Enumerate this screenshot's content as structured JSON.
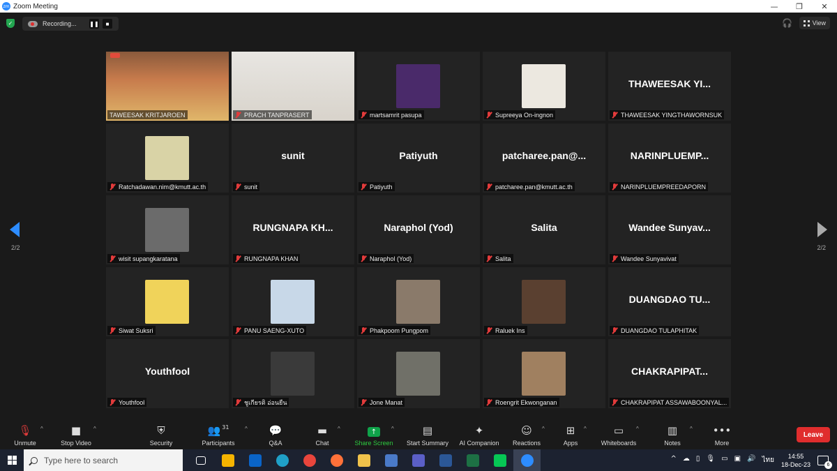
{
  "window": {
    "title": "Zoom Meeting",
    "logo_text": "zm",
    "controls": [
      "—",
      "❐",
      "✕"
    ]
  },
  "topbar": {
    "recording_label": "Recording...",
    "pause_symbol": "❚❚",
    "stop_symbol": "■",
    "view_label": "View"
  },
  "gallery": {
    "page_left": "2/2",
    "page_right": "2/2",
    "tiles": [
      {
        "name": "TAWEESAK KRITJAROEN",
        "display": "",
        "kind": "video1",
        "muted": false
      },
      {
        "name": "PRACH TANPRASERT",
        "display": "",
        "kind": "video2",
        "muted": true
      },
      {
        "name": "martsamrit pasupa",
        "display": "",
        "kind": "avatar",
        "color": "#4a2a6a",
        "muted": true
      },
      {
        "name": "Supreeya On-ingnon",
        "display": "",
        "kind": "avatar",
        "color": "#ece8e0",
        "muted": true
      },
      {
        "name": "THAWEESAK YINGTHAWORNSUK",
        "display": "THAWEESAK  YI...",
        "kind": "text",
        "muted": true
      },
      {
        "name": "Ratchadawan.nim@kmutt.ac.th",
        "display": "",
        "kind": "avatar",
        "color": "#d9d3a6",
        "muted": true
      },
      {
        "name": "sunit",
        "display": "sunit",
        "kind": "text",
        "muted": true
      },
      {
        "name": "Patiyuth",
        "display": "Patiyuth",
        "kind": "text",
        "muted": true
      },
      {
        "name": "patcharee.pan@kmutt.ac.th",
        "display": "patcharee.pan@...",
        "kind": "text",
        "muted": true
      },
      {
        "name": "NARINPLUEMPREEDAPORN",
        "display": "NARINPLUEMP...",
        "kind": "text",
        "muted": true
      },
      {
        "name": "wisit supangkaratana",
        "display": "",
        "kind": "avatar",
        "color": "#6b6b6b",
        "muted": true
      },
      {
        "name": "RUNGNAPA KHAN",
        "display": "RUNGNAPA  KH...",
        "kind": "text",
        "muted": true
      },
      {
        "name": "Naraphol (Yod)",
        "display": "Naraphol (Yod)",
        "kind": "text",
        "muted": true
      },
      {
        "name": "Salita",
        "display": "Salita",
        "kind": "text",
        "muted": true
      },
      {
        "name": "Wandee Sunyavivat",
        "display": "Wandee  Sunyav...",
        "kind": "text",
        "muted": true
      },
      {
        "name": "Siwat Suksri",
        "display": "",
        "kind": "avatar",
        "color": "#f0d35a",
        "muted": true
      },
      {
        "name": "PANU SAENG-XUTO",
        "display": "",
        "kind": "avatar",
        "color": "#c8d8e8",
        "muted": true
      },
      {
        "name": "Phakpoom Pungpom",
        "display": "",
        "kind": "avatar",
        "color": "#8a7a6a",
        "muted": true
      },
      {
        "name": "Raluek Ins",
        "display": "",
        "kind": "avatar",
        "color": "#5a4030",
        "muted": true
      },
      {
        "name": "DUANGDAO TULAPHITAK",
        "display": "DUANGDAO  TU...",
        "kind": "text",
        "muted": true
      },
      {
        "name": "Youthfool",
        "display": "Youthfool",
        "kind": "text",
        "muted": true
      },
      {
        "name": "ชูเกียรติ อ่อนยืน",
        "display": "",
        "kind": "avatar",
        "color": "#3a3a3a",
        "muted": true
      },
      {
        "name": "Jone Manat",
        "display": "",
        "kind": "avatar",
        "color": "#707068",
        "muted": true
      },
      {
        "name": "Roengrit Ekwonganan",
        "display": "",
        "kind": "avatar",
        "color": "#a08060",
        "muted": true
      },
      {
        "name": "CHAKRAPIPAT ASSAWABOONYAL...",
        "display": "CHAKRAPIPAT...",
        "kind": "text",
        "muted": true
      }
    ]
  },
  "toolbar": {
    "unmute": "Unmute",
    "stop_video": "Stop Video",
    "security": "Security",
    "participants": "Participants",
    "participants_count": "31",
    "qa": "Q&A",
    "chat": "Chat",
    "share_screen": "Share Screen",
    "start_summary": "Start Summary",
    "ai_companion": "AI Companion",
    "reactions": "Reactions",
    "apps": "Apps",
    "whiteboards": "Whiteboards",
    "notes": "Notes",
    "more": "More",
    "leave": "Leave"
  },
  "taskbar": {
    "search_placeholder": "Type here to search",
    "time": "14:55",
    "date": "18-Dec-23",
    "language": "ไทย",
    "notification_count": "6",
    "apps": [
      {
        "name": "task-view",
        "color": "#1c2230"
      },
      {
        "name": "microsoft-store",
        "color": "#f5b400"
      },
      {
        "name": "outlook",
        "color": "#0a64c8"
      },
      {
        "name": "edge",
        "color": "#1fa0c8"
      },
      {
        "name": "chrome",
        "color": "#e8453c"
      },
      {
        "name": "firefox",
        "color": "#ff7139"
      },
      {
        "name": "file-explorer",
        "color": "#f0c24b"
      },
      {
        "name": "remote-app",
        "color": "#4a7ac8"
      },
      {
        "name": "teams",
        "color": "#5b5fc7"
      },
      {
        "name": "word",
        "color": "#2b5797"
      },
      {
        "name": "excel",
        "color": "#1d7044"
      },
      {
        "name": "line",
        "color": "#06c755"
      },
      {
        "name": "zoom",
        "color": "#2d8cff"
      }
    ]
  }
}
